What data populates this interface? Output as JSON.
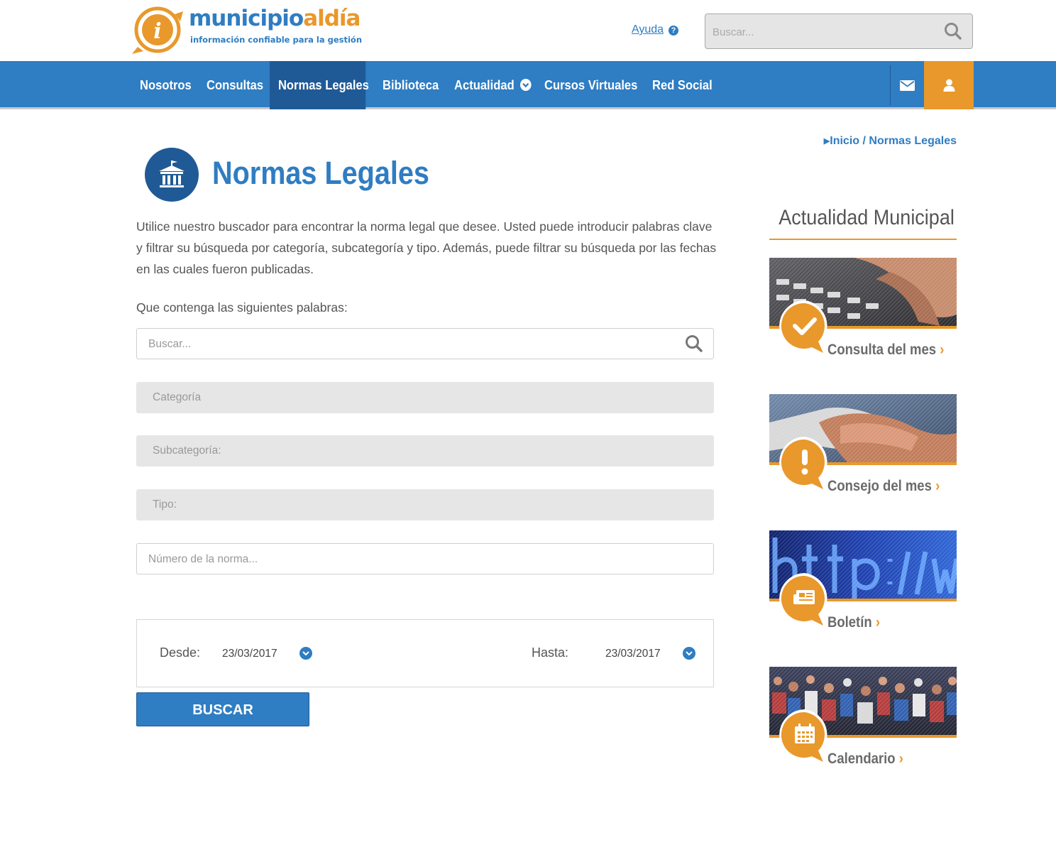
{
  "header": {
    "logo": {
      "brand_part1": "municipio",
      "brand_part2": "aldía",
      "tagline": "información confiable para la gestión"
    },
    "help_label": "Ayuda",
    "search_placeholder": "Buscar..."
  },
  "nav": {
    "items": [
      {
        "label": "Nosotros"
      },
      {
        "label": "Consultas"
      },
      {
        "label": "Normas Legales",
        "active": true
      },
      {
        "label": "Biblioteca"
      },
      {
        "label": "Actualidad",
        "dropdown": true
      },
      {
        "label": "Cursos Virtuales"
      },
      {
        "label": "Red Social"
      }
    ],
    "icons": [
      "envelope-icon",
      "user-icon"
    ]
  },
  "breadcrumb": "Inicio / Normas Legales",
  "page": {
    "title": "Normas Legales",
    "intro": "Utilice nuestro buscador para encontrar la norma legal que desee. Usted puede introducir palabras clave y filtrar su búsqueda por categoría, subcategoría y tipo. Además, puede filtrar su búsqueda por las fechas en las cuales fueron publicadas.",
    "keywords_label": "Que contenga las siguientes palabras:"
  },
  "form": {
    "keywords_placeholder": "Buscar...",
    "category": "Categoría",
    "subcategory": "Subcategoría:",
    "type": "Tipo:",
    "number_placeholder": "Número de la norma...",
    "from_label": "Desde:",
    "from_value": "23/03/2017",
    "to_label": "Hasta:",
    "to_value": "23/03/2017",
    "submit": "BUSCAR"
  },
  "sidebar": {
    "title": "Actualidad Municipal",
    "cards": [
      {
        "label": "Consulta del mes",
        "icon": "check-icon"
      },
      {
        "label": "Consejo del mes",
        "icon": "exclamation-icon"
      },
      {
        "label": "Boletín",
        "icon": "newspaper-icon"
      },
      {
        "label": "Calendario",
        "icon": "calendar-icon"
      }
    ]
  },
  "colors": {
    "primary": "#2f7dc2",
    "primary_dark": "#205a96",
    "accent": "#e9982b"
  }
}
